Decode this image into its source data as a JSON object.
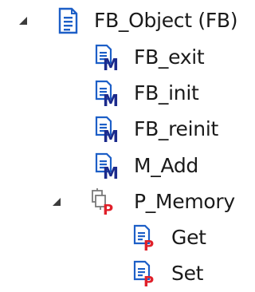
{
  "tree": {
    "root": {
      "label": "FB_Object (FB)",
      "icon": "function-block-icon",
      "expanded": true
    },
    "children": [
      {
        "label": "FB_exit",
        "icon": "method-icon"
      },
      {
        "label": "FB_init",
        "icon": "method-icon"
      },
      {
        "label": "FB_reinit",
        "icon": "method-icon"
      },
      {
        "label": "M_Add",
        "icon": "method-icon"
      },
      {
        "label": "P_Memory",
        "icon": "property-icon",
        "expanded": true,
        "children": [
          {
            "label": "Get",
            "icon": "property-accessor-icon"
          },
          {
            "label": "Set",
            "icon": "property-accessor-icon"
          }
        ]
      }
    ]
  },
  "colors": {
    "doc_blue": "#1d5fc7",
    "method_letter": "#1b2a8c",
    "property_letter": "#e0202a",
    "expander": "#3c3c3c"
  }
}
